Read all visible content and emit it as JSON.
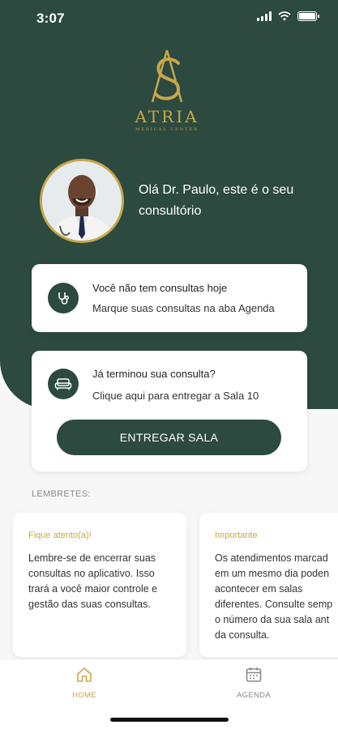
{
  "status_bar": {
    "time": "3:07"
  },
  "brand": {
    "name": "ATRIA",
    "subtitle": "MEDICAL CENTER"
  },
  "greeting": "Olá Dr. Paulo, este é o seu consultório",
  "appointments_card": {
    "title": "Você não tem consultas hoje",
    "subtitle": "Marque suas consultas na aba Agenda",
    "icon": "stethoscope-icon"
  },
  "room_card": {
    "title": "Já terminou sua consulta?",
    "subtitle": "Clique aqui para entregar a Sala 10",
    "button": "ENTREGAR SALA",
    "icon": "sofa-icon"
  },
  "reminders": {
    "label": "LEMBRETES:",
    "items": [
      {
        "title": "Fique atento(a)!",
        "lines": [
          "Lembre-se de encerrar suas",
          "consultas no aplicativo. Isso",
          "trará a você maior controle e",
          "gestão das suas consultas."
        ]
      },
      {
        "title": "Importante",
        "lines": [
          "Os atendimentos marcad",
          "em um mesmo dia poden",
          "acontecer em salas",
          "diferentes. Consulte semp",
          "o número da sua sala ant",
          "da consulta."
        ]
      }
    ]
  },
  "tabs": [
    {
      "label": "HOME",
      "icon": "home-icon",
      "active": true
    },
    {
      "label": "AGENDA",
      "icon": "calendar-icon",
      "active": false
    }
  ],
  "colors": {
    "primary": "#2c4a3f",
    "gold": "#c8a64a",
    "background": "#f7f7f7"
  }
}
